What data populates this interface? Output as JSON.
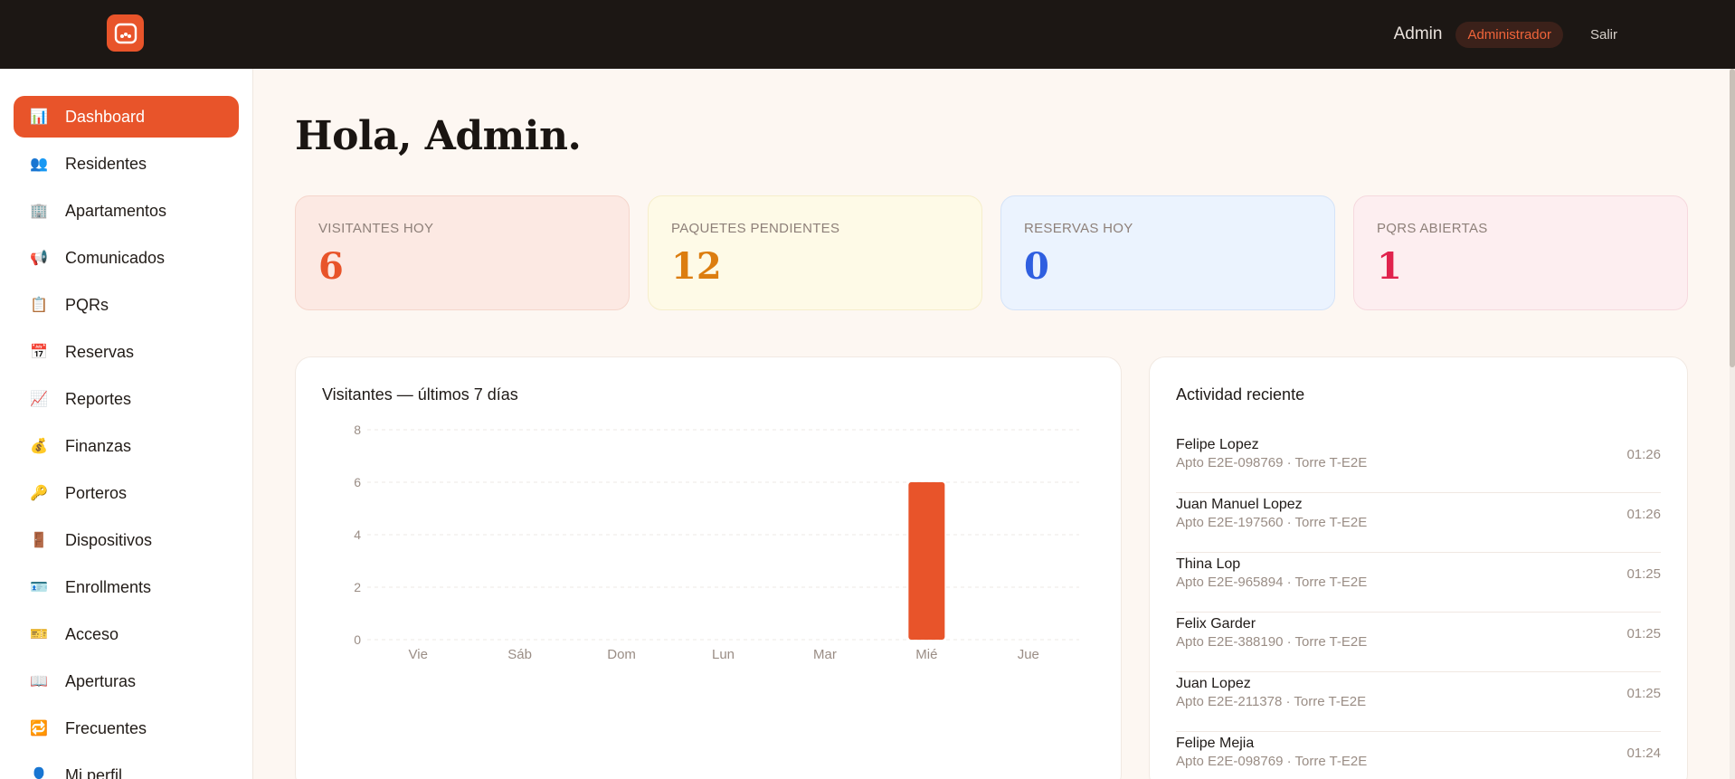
{
  "topbar": {
    "user_name": "Admin",
    "role_badge": "Administrador",
    "logout_label": "Salir",
    "accent": "#e8542a"
  },
  "sidebar": {
    "items": [
      {
        "label": "Dashboard",
        "icon": "bar-chart-icon",
        "glyph": "📊",
        "active": true
      },
      {
        "label": "Residentes",
        "icon": "people-icon",
        "glyph": "👥"
      },
      {
        "label": "Apartamentos",
        "icon": "building-icon",
        "glyph": "🏢"
      },
      {
        "label": "Comunicados",
        "icon": "megaphone-icon",
        "glyph": "📢"
      },
      {
        "label": "PQRs",
        "icon": "clipboard-icon",
        "glyph": "📋"
      },
      {
        "label": "Reservas",
        "icon": "calendar-icon",
        "glyph": "📅"
      },
      {
        "label": "Reportes",
        "icon": "trend-chart-icon",
        "glyph": "📈"
      },
      {
        "label": "Finanzas",
        "icon": "money-bag-icon",
        "glyph": "💰"
      },
      {
        "label": "Porteros",
        "icon": "key-icon",
        "glyph": "🔑"
      },
      {
        "label": "Dispositivos",
        "icon": "door-icon",
        "glyph": "🚪"
      },
      {
        "label": "Enrollments",
        "icon": "id-card-icon",
        "glyph": "🪪"
      },
      {
        "label": "Acceso",
        "icon": "ticket-icon",
        "glyph": "🎫"
      },
      {
        "label": "Aperturas",
        "icon": "book-icon",
        "glyph": "📖"
      },
      {
        "label": "Frecuentes",
        "icon": "repeat-icon",
        "glyph": "🔁"
      },
      {
        "label": "Mi perfil",
        "icon": "person-icon",
        "glyph": "👤"
      }
    ]
  },
  "main": {
    "greeting": "Hola, Admin.",
    "stats": [
      {
        "label": "VISITANTES HOY",
        "value": "6",
        "bg": "#fce9e3",
        "border": "#f5d6cc",
        "color": "#e8542a"
      },
      {
        "label": "PAQUETES PENDIENTES",
        "value": "12",
        "bg": "#fefae7",
        "border": "#f6eecb",
        "color": "#dc7d10"
      },
      {
        "label": "RESERVAS HOY",
        "value": "0",
        "bg": "#ebf3fe",
        "border": "#d4e3f8",
        "color": "#2f5fe0"
      },
      {
        "label": "PQRS ABIERTAS",
        "value": "1",
        "bg": "#fdeef0",
        "border": "#f6d9de",
        "color": "#e0234d"
      }
    ],
    "chart_title": "Visitantes — últimos 7 días",
    "activity_title": "Actividad reciente",
    "activity": [
      {
        "name": "Felipe Lopez",
        "sub": "Apto E2E-098769 · Torre T-E2E",
        "time": "01:26"
      },
      {
        "name": "Juan Manuel Lopez",
        "sub": "Apto E2E-197560 · Torre T-E2E",
        "time": "01:26"
      },
      {
        "name": "Thina Lop",
        "sub": "Apto E2E-965894 · Torre T-E2E",
        "time": "01:25"
      },
      {
        "name": "Felix Garder",
        "sub": "Apto E2E-388190 · Torre T-E2E",
        "time": "01:25"
      },
      {
        "name": "Juan Lopez",
        "sub": "Apto E2E-211378 · Torre T-E2E",
        "time": "01:25"
      },
      {
        "name": "Felipe Mejia",
        "sub": "Apto E2E-098769 · Torre T-E2E",
        "time": "01:24"
      }
    ]
  },
  "chart_data": {
    "type": "bar",
    "title": "Visitantes — últimos 7 días",
    "categories": [
      "Vie",
      "Sáb",
      "Dom",
      "Lun",
      "Mar",
      "Mié",
      "Jue"
    ],
    "values": [
      0,
      0,
      0,
      0,
      0,
      6,
      0
    ],
    "yticks": [
      "0",
      "2",
      "4",
      "6",
      "8"
    ],
    "ylim": [
      0,
      8
    ],
    "grid": true,
    "bar_color": "#e8542a",
    "legend": "none"
  }
}
